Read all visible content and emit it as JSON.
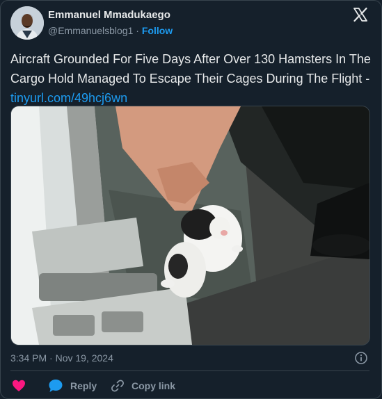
{
  "author": {
    "name": "Emmanuel Mmadukaego",
    "handle": "@Emmanuelsblog1",
    "separator": "·",
    "follow_label": "Follow"
  },
  "tweet": {
    "text": "Aircraft Grounded For Five Days After Over 130 Hamsters In The Cargo Hold Managed To Escape Their Cages During The Flight - ",
    "link_text": "tinyurl.com/49hcj6wn",
    "timestamp": "3:34 PM · Nov 19, 2024"
  },
  "actions": {
    "reply_label": "Reply",
    "copy_link_label": "Copy link"
  },
  "colors": {
    "background": "#15202b",
    "accent": "#1d9bf0",
    "like": "#f91880",
    "muted_text": "#8b98a5",
    "border": "#38444d"
  },
  "icons": [
    "x-logo-icon",
    "info-icon",
    "heart-icon",
    "reply-bubble-icon",
    "link-icon"
  ]
}
